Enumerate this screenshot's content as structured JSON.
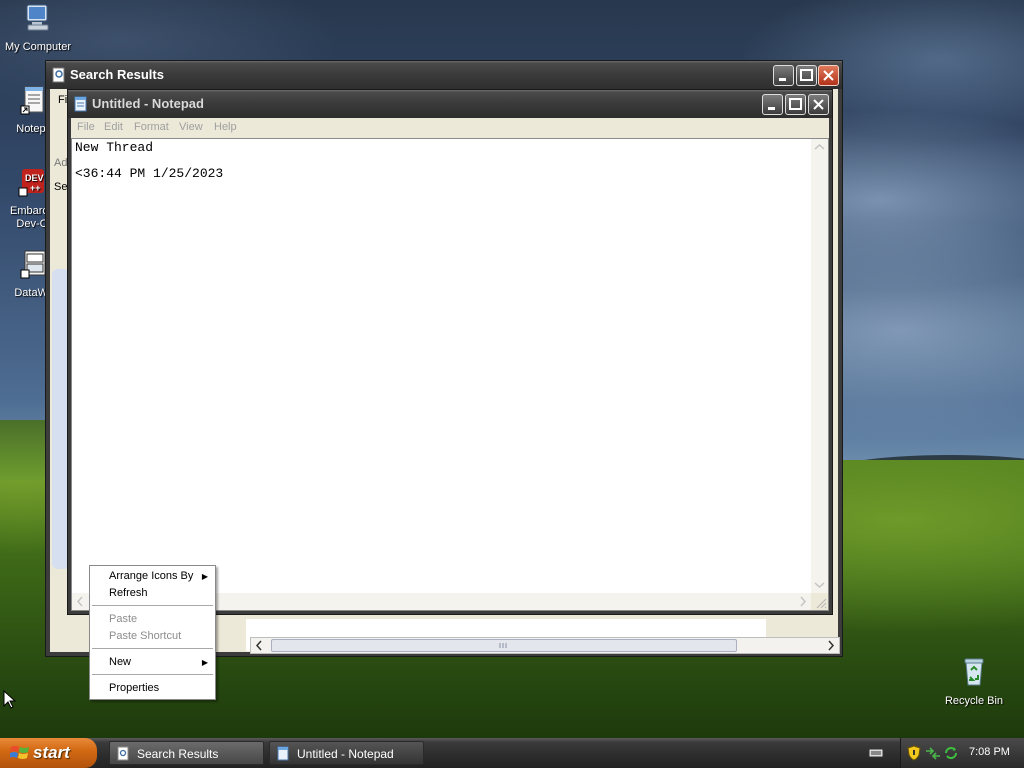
{
  "desktop": {
    "icons": [
      {
        "label": "My Computer",
        "icon": "computer-icon"
      },
      {
        "label": "Notepa",
        "icon": "notepad-shortcut-icon"
      },
      {
        "label": "Embarca",
        "label2": "Dev-C",
        "icon": "devcpp-icon"
      },
      {
        "label": "DataWa",
        "icon": "datawave-icon"
      },
      {
        "label": "Recycle Bin",
        "icon": "recycle-bin-icon"
      }
    ]
  },
  "search_window": {
    "title": "Search Results",
    "partial_texts": [
      "Fi",
      "Ad",
      "Se"
    ]
  },
  "notepad": {
    "title": "Untitled - Notepad",
    "menu": [
      "File",
      "Edit",
      "Format",
      "View",
      "Help"
    ],
    "text_lines": [
      "New Thread",
      "",
      "<36:44 PM 1/25/2023"
    ]
  },
  "context_menu": {
    "items": [
      {
        "label": "Arrange Icons By",
        "submenu": true,
        "disabled": false
      },
      {
        "label": "Refresh",
        "submenu": false,
        "disabled": false
      },
      {
        "label": "Paste",
        "submenu": false,
        "disabled": true
      },
      {
        "label": "Paste Shortcut",
        "submenu": false,
        "disabled": true
      },
      {
        "label": "New",
        "submenu": true,
        "disabled": false
      },
      {
        "label": "Properties",
        "submenu": false,
        "disabled": false
      }
    ]
  },
  "taskbar": {
    "start_label": "start",
    "tasks": [
      {
        "label": "Search Results",
        "icon": "search-results-icon"
      },
      {
        "label": "Untitled - Notepad",
        "icon": "notepad-icon"
      }
    ],
    "clock": "7:08 PM"
  },
  "colors": {
    "start_orange": "#d36a14",
    "close_red": "#b2321a",
    "titlebar_gray": "#3a3a3a"
  }
}
